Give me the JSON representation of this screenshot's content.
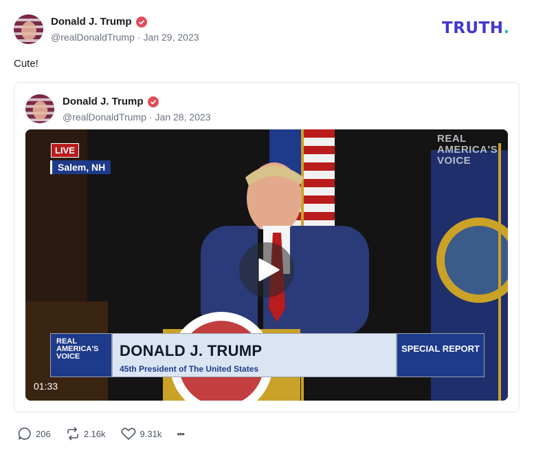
{
  "post": {
    "author_name": "Donald J. Trump",
    "handle": "@realDonaldTrump",
    "separator": "·",
    "date": "Jan 29, 2023",
    "text": "Cute!"
  },
  "logo": {
    "text": "TRUTH",
    "dot": "."
  },
  "quoted": {
    "author_name": "Donald J. Trump",
    "handle": "@realDonaldTrump",
    "separator": "·",
    "date": "Jan 28, 2023",
    "video": {
      "live_label": "LIVE",
      "location": "Salem, NH",
      "watermark": [
        "REAL",
        "AMERICA'S",
        "VOICE"
      ],
      "lower_third": {
        "logo_lines": [
          "REAL",
          "AMERICA'S",
          "VOICE"
        ],
        "name": "DONALD J. TRUMP",
        "subtitle": "45th President of The United States",
        "badge": "SPECIAL REPORT"
      },
      "duration": "01:33"
    }
  },
  "actions": {
    "replies": "206",
    "retruths": "2.16k",
    "likes": "9.31k",
    "more": "•••"
  },
  "icons": {
    "verified": "verified-badge-icon",
    "reply": "comment-bubble-icon",
    "retruth": "retruth-arrows-icon",
    "like": "heart-icon",
    "more": "more-dots-icon",
    "play": "play-icon"
  },
  "colors": {
    "brand": "#4338ca",
    "brand_dot": "#25c3b0",
    "verified": "#e14d5a",
    "muted": "#6b7280"
  }
}
